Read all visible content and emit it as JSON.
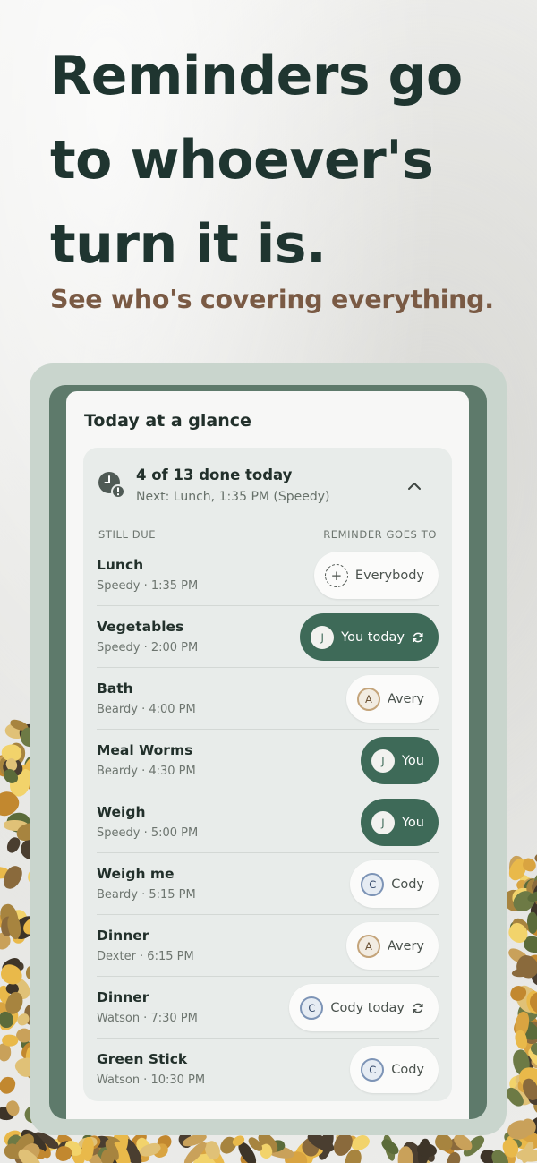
{
  "headline": "Reminders go to whoever's turn it is.",
  "subline": "See who's covering everything.",
  "colors": {
    "accent": "#3e6a58",
    "headline": "#1f3530",
    "subline": "#7a5a44"
  },
  "screen": {
    "title": "Today at a glance",
    "summary": {
      "icon": "clock-alert-icon",
      "title": "4 of 13 done today",
      "next": "Next: Lunch, 1:35 PM (Speedy)",
      "toggle_icon": "chevron-up-icon"
    },
    "columns": {
      "left": "STILL DUE",
      "right": "REMINDER GOES TO"
    },
    "rows": [
      {
        "name": "Lunch",
        "meta": "Speedy · 1:35 PM",
        "assignee": "Everybody",
        "initial": "+",
        "style": "everyone",
        "dark": false,
        "sync": false
      },
      {
        "name": "Vegetables",
        "meta": "Speedy · 2:00 PM",
        "assignee": "You today",
        "initial": "J",
        "style": "white",
        "dark": true,
        "sync": true
      },
      {
        "name": "Bath",
        "meta": "Beardy · 4:00 PM",
        "assignee": "Avery",
        "initial": "A",
        "style": "avery",
        "dark": false,
        "sync": false
      },
      {
        "name": "Meal Worms",
        "meta": "Beardy · 4:30 PM",
        "assignee": "You",
        "initial": "J",
        "style": "white",
        "dark": true,
        "sync": false
      },
      {
        "name": "Weigh",
        "meta": "Speedy · 5:00 PM",
        "assignee": "You",
        "initial": "J",
        "style": "white",
        "dark": true,
        "sync": false
      },
      {
        "name": "Weigh me",
        "meta": "Beardy · 5:15 PM",
        "assignee": "Cody",
        "initial": "C",
        "style": "cody",
        "dark": false,
        "sync": false
      },
      {
        "name": "Dinner",
        "meta": "Dexter · 6:15 PM",
        "assignee": "Avery",
        "initial": "A",
        "style": "avery",
        "dark": false,
        "sync": false
      },
      {
        "name": "Dinner",
        "meta": "Watson · 7:30 PM",
        "assignee": "Cody today",
        "initial": "C",
        "style": "cody",
        "dark": false,
        "sync": true
      },
      {
        "name": "Green Stick",
        "meta": "Watson · 10:30 PM",
        "assignee": "Cody",
        "initial": "C",
        "style": "cody",
        "dark": false,
        "sync": false
      }
    ]
  }
}
